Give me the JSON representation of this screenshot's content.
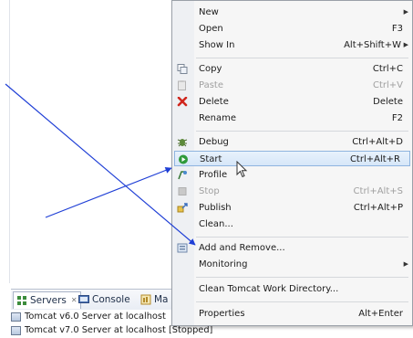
{
  "servers_panel": {
    "tabs": [
      {
        "label": "Servers",
        "close": "✕",
        "active": true
      },
      {
        "label": "Console",
        "active": false
      },
      {
        "label": "Ma",
        "active": false
      }
    ],
    "rows": [
      {
        "label": "Tomcat v6.0 Server at localhost"
      },
      {
        "label": "Tomcat v7.0 Server at localhost  [Stopped]"
      }
    ]
  },
  "context_menu": {
    "items": [
      {
        "label": "New",
        "accel": "",
        "submenu": true,
        "disabled": false,
        "icon": "none"
      },
      {
        "label": "Open",
        "accel": "F3",
        "submenu": false,
        "disabled": false,
        "icon": "none"
      },
      {
        "label": "Show In",
        "accel": "Alt+Shift+W",
        "submenu": true,
        "disabled": false,
        "icon": "none"
      },
      {
        "label": "Copy",
        "accel": "Ctrl+C",
        "submenu": false,
        "disabled": false,
        "icon": "copy-icon"
      },
      {
        "label": "Paste",
        "accel": "Ctrl+V",
        "submenu": false,
        "disabled": true,
        "icon": "paste-icon"
      },
      {
        "label": "Delete",
        "accel": "Delete",
        "submenu": false,
        "disabled": false,
        "icon": "delete-icon"
      },
      {
        "label": "Rename",
        "accel": "F2",
        "submenu": false,
        "disabled": false,
        "icon": "none"
      },
      {
        "label": "Debug",
        "accel": "Ctrl+Alt+D",
        "submenu": false,
        "disabled": false,
        "icon": "debug-icon"
      },
      {
        "label": "Start",
        "accel": "Ctrl+Alt+R",
        "submenu": false,
        "disabled": false,
        "icon": "start-icon",
        "highlighted": true
      },
      {
        "label": "Profile",
        "accel": "",
        "submenu": false,
        "disabled": false,
        "icon": "profile-icon"
      },
      {
        "label": "Stop",
        "accel": "Ctrl+Alt+S",
        "submenu": false,
        "disabled": true,
        "icon": "stop-icon"
      },
      {
        "label": "Publish",
        "accel": "Ctrl+Alt+P",
        "submenu": false,
        "disabled": false,
        "icon": "publish-icon"
      },
      {
        "label": "Clean...",
        "accel": "",
        "submenu": false,
        "disabled": false,
        "icon": "none"
      },
      {
        "label": "Add and Remove...",
        "accel": "",
        "submenu": false,
        "disabled": false,
        "icon": "add-remove-icon"
      },
      {
        "label": "Monitoring",
        "accel": "",
        "submenu": true,
        "disabled": false,
        "icon": "none"
      },
      {
        "label": "Clean Tomcat Work Directory...",
        "accel": "",
        "submenu": false,
        "disabled": false,
        "icon": "none"
      },
      {
        "label": "Properties",
        "accel": "Alt+Enter",
        "submenu": false,
        "disabled": false,
        "icon": "none"
      }
    ]
  },
  "annotation_color": "#1f3fd6"
}
